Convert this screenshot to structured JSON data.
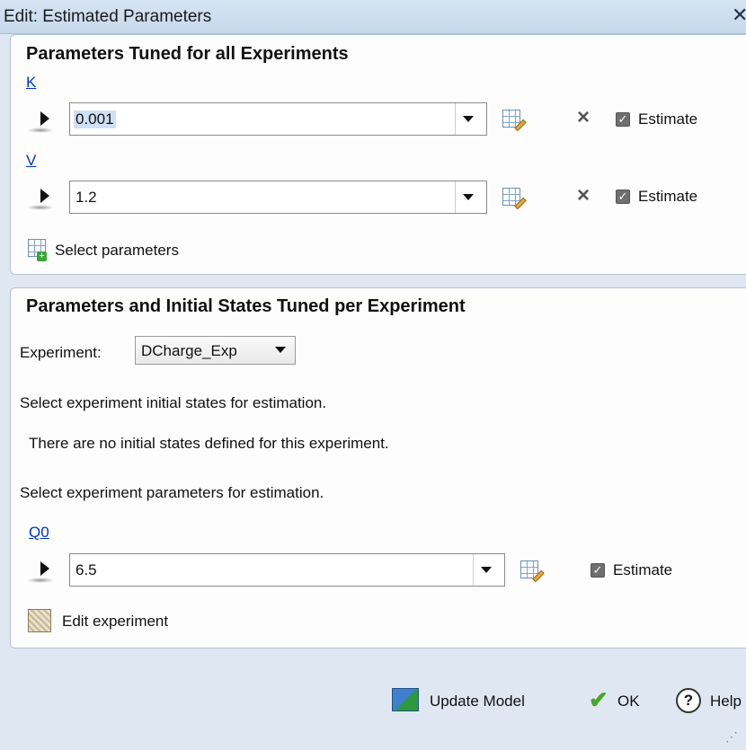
{
  "window": {
    "title": "Edit: Estimated Parameters",
    "close_glyph": "✕"
  },
  "section1": {
    "title": "Parameters Tuned for all Experiments",
    "params": [
      {
        "name": "K",
        "value": "0.001",
        "estimate_label": "Estimate",
        "estimate_checked": true
      },
      {
        "name": "V",
        "value": "1.2",
        "estimate_label": "Estimate",
        "estimate_checked": true
      }
    ],
    "select_parameters_label": "Select parameters"
  },
  "section2": {
    "title": "Parameters and Initial States Tuned per Experiment",
    "experiment_label": "Experiment:",
    "experiment_value": "DCharge_Exp",
    "initial_states_prompt": "Select experiment initial states for estimation.",
    "no_initial_states_message": "There are no initial states defined for this experiment.",
    "experiment_params_prompt": "Select experiment parameters for estimation.",
    "params": [
      {
        "name": "Q0",
        "value": "6.5",
        "estimate_label": "Estimate",
        "estimate_checked": true
      }
    ],
    "edit_experiment_label": "Edit experiment"
  },
  "footer": {
    "update_model_label": "Update Model",
    "ok_label": "OK",
    "help_label": "Help"
  },
  "icons": {
    "expander": "expand-arrow-icon",
    "edit_table": "edit-table-icon",
    "delete": "delete-x-icon",
    "select_parameters": "add-grid-icon",
    "edit_experiment": "edit-experiment-icon",
    "update_model": "update-model-icon",
    "ok": "green-check-icon",
    "help": "help-circle-icon"
  }
}
